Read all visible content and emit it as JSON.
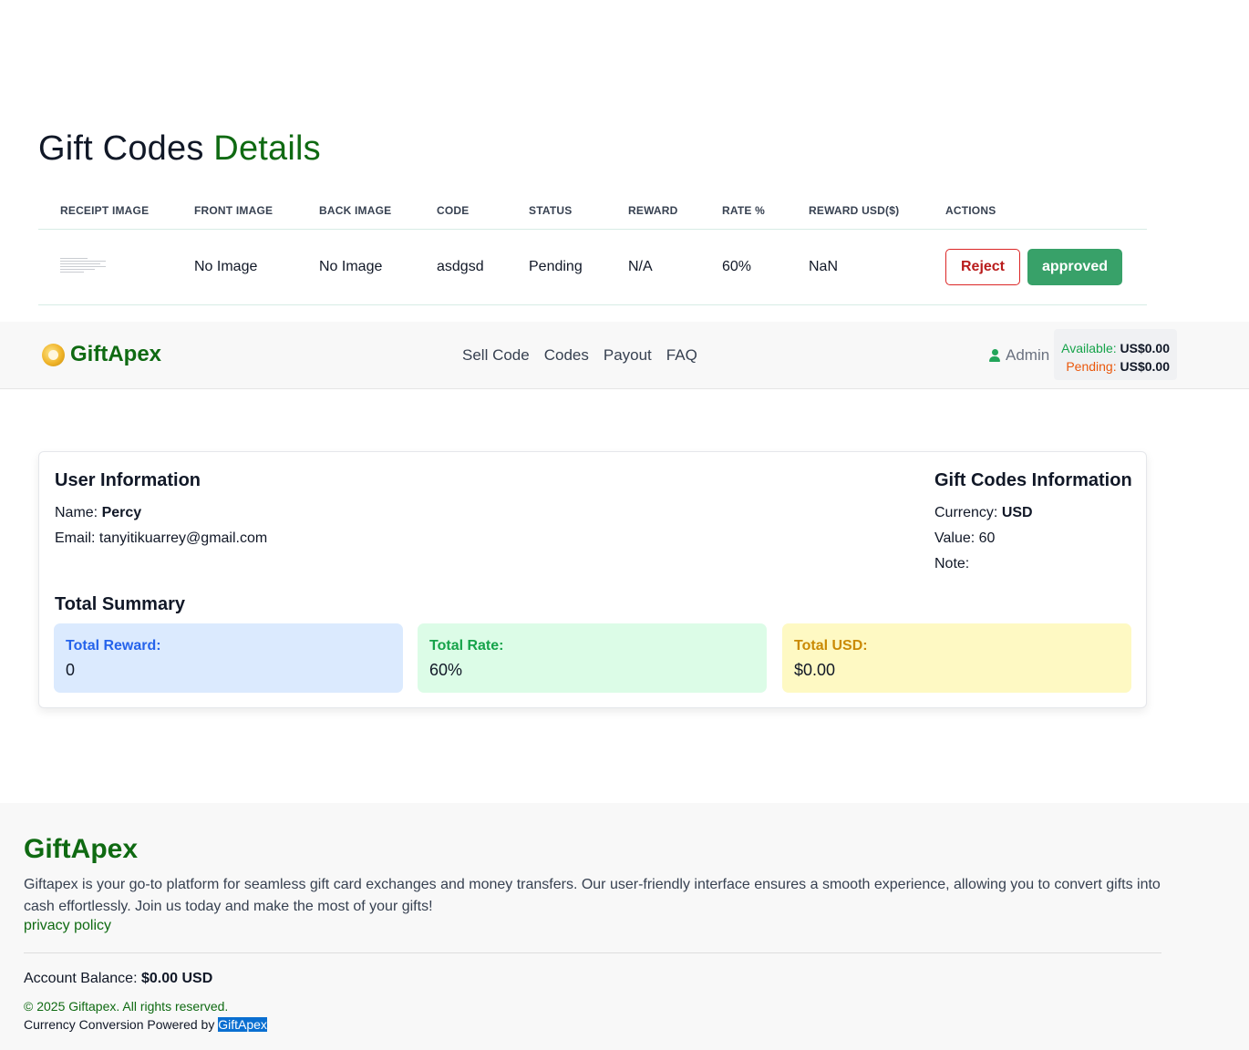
{
  "page": {
    "title_main": "Gift Codes",
    "title_accent": "Details"
  },
  "table": {
    "headers": [
      "Receipt Image",
      "Front Image",
      "Back Image",
      "Code",
      "Status",
      "Reward",
      "Rate %",
      "Reward USD($)",
      "Actions"
    ],
    "rows": [
      {
        "front_image": "No Image",
        "back_image": "No Image",
        "code": "asdgsd",
        "status": "Pending",
        "reward": "N/A",
        "rate": "60%",
        "reward_usd": "NaN",
        "reject_label": "Reject",
        "approve_label": "approved"
      }
    ]
  },
  "navbar": {
    "brand": "GiftApex",
    "links": [
      "Sell Code",
      "Codes",
      "Payout",
      "FAQ"
    ],
    "admin_label": "Admin",
    "available_label": "Available:",
    "available_value": "US$0.00",
    "pending_label": "Pending:",
    "pending_value": "US$0.00"
  },
  "user_info": {
    "heading": "User Information",
    "name_label": "Name:",
    "name_value": "Percy",
    "email_label": "Email:",
    "email_value": "tanyitikuarrey@gmail.com"
  },
  "codes_info": {
    "heading": "Gift Codes Information",
    "currency_label": "Currency:",
    "currency_value": "USD",
    "value_label": "Value:",
    "value_value": "60",
    "note_label": "Note:"
  },
  "summary": {
    "heading": "Total Summary",
    "reward_label": "Total Reward:",
    "reward_value": "0",
    "rate_label": "Total Rate:",
    "rate_value": "60%",
    "usd_label": "Total USD:",
    "usd_value": "$0.00"
  },
  "footer": {
    "brand": "GiftApex",
    "description": "Giftapex is your go-to platform for seamless gift card exchanges and money transfers. Our user-friendly interface ensures a smooth experience, allowing you to convert gifts into cash effortlessly. Join us today and make the most of your gifts!",
    "privacy_link": "privacy policy",
    "balance_label": "Account Balance:",
    "balance_value": "$0.00 USD",
    "copyright": "© 2025 Giftapex. All rights reserved.",
    "powered_prefix": "Currency Conversion Powered by",
    "powered_brand": "GiftApex"
  },
  "colors": {
    "brand_green": "#0f6a12",
    "approve_green": "#38a169",
    "reject_red": "#dc2626",
    "pending_yellow": "#eab308"
  },
  "icons": {
    "brand_logo": "giftapex-logo-icon",
    "admin": "user-icon"
  }
}
